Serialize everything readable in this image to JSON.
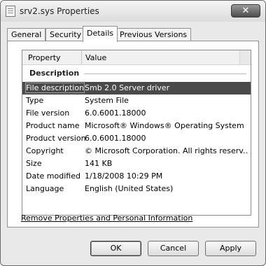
{
  "window": {
    "title": "srv2.sys Properties",
    "close_glyph": "✕",
    "icon": "document-icon"
  },
  "tabs": [
    {
      "label": "General",
      "active": false
    },
    {
      "label": "Security",
      "active": false
    },
    {
      "label": "Details",
      "active": true
    },
    {
      "label": "Previous Versions",
      "active": false
    }
  ],
  "list": {
    "columns": [
      "Property",
      "Value"
    ],
    "group": "Description",
    "rows": [
      {
        "property": "File description",
        "value": "Smb 2.0 Server driver",
        "selected": true
      },
      {
        "property": "Type",
        "value": "System File"
      },
      {
        "property": "File version",
        "value": "6.0.6001.18000"
      },
      {
        "property": "Product name",
        "value": "Microsoft® Windows® Operating System"
      },
      {
        "property": "Product version",
        "value": "6.0.6001.18000"
      },
      {
        "property": "Copyright",
        "value": "© Microsoft Corporation. All rights reserv..."
      },
      {
        "property": "Size",
        "value": "141 KB"
      },
      {
        "property": "Date modified",
        "value": "1/18/2008 10:29 PM"
      },
      {
        "property": "Language",
        "value": "English (United States)"
      }
    ]
  },
  "remove_link": "Remove Properties and Personal Information",
  "buttons": {
    "ok": "OK",
    "cancel": "Cancel",
    "apply": "Apply"
  }
}
